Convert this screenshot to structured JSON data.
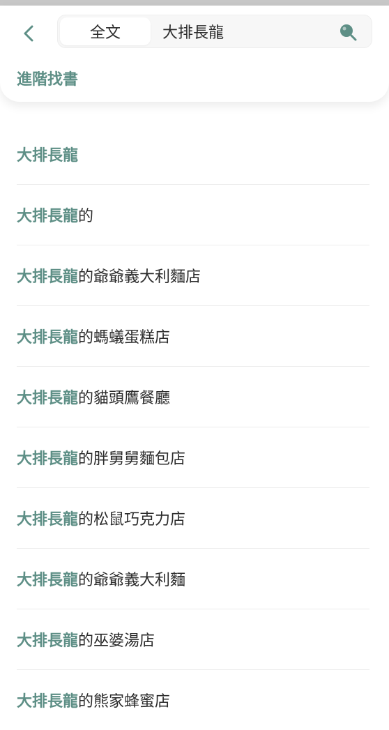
{
  "header": {
    "scope_label": "全文",
    "search_value": "大排長龍",
    "advanced_label": "進階找書"
  },
  "colors": {
    "accent": "#5e8f86",
    "text": "#2b2b2b",
    "divider": "#ececec"
  },
  "icons": {
    "back": "chevron-left-icon",
    "search": "search-icon"
  },
  "results": [
    {
      "highlight": "大排長龍",
      "rest": ""
    },
    {
      "highlight": "大排長龍",
      "rest": "的"
    },
    {
      "highlight": "大排長龍",
      "rest": "的爺爺義大利麵店"
    },
    {
      "highlight": "大排長龍",
      "rest": "的螞蟻蛋糕店"
    },
    {
      "highlight": "大排長龍",
      "rest": "的貓頭鷹餐廳"
    },
    {
      "highlight": "大排長龍",
      "rest": "的胖舅舅麵包店"
    },
    {
      "highlight": "大排長龍",
      "rest": "的松鼠巧克力店"
    },
    {
      "highlight": "大排長龍",
      "rest": "的爺爺義大利麵"
    },
    {
      "highlight": "大排長龍",
      "rest": "的巫婆湯店"
    },
    {
      "highlight": "大排長龍",
      "rest": "的熊家蜂蜜店"
    }
  ]
}
